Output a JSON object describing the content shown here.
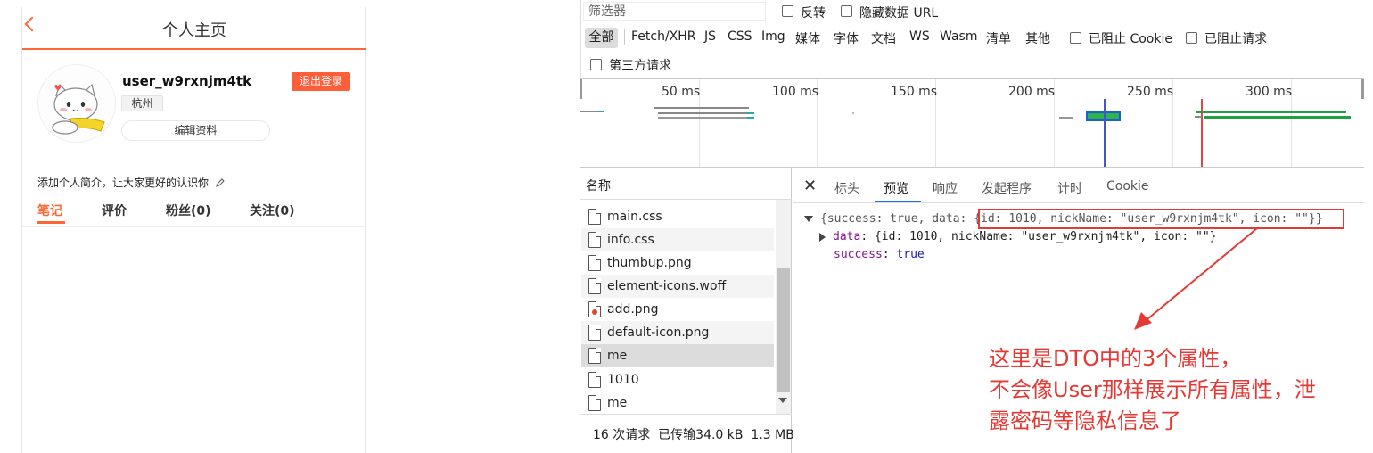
{
  "app": {
    "title": "个人主页",
    "username": "user_w9rxnjm4tk",
    "logout_label": "退出登录",
    "city": "杭州",
    "edit_profile_label": "编辑资料",
    "intro_placeholder": "添加个人简介，让大家更好的认识你",
    "tabs": [
      "笔记",
      "评价",
      "粉丝(0)",
      "关注(0)"
    ],
    "accent_color": "#ff6633"
  },
  "devtools": {
    "filter_placeholder": "筛选器",
    "invert_label": "反转",
    "hide_data_url_label": "隐藏数据 URL",
    "type_filters": [
      "全部",
      "Fetch/XHR",
      "JS",
      "CSS",
      "Img",
      "媒体",
      "字体",
      "文档",
      "WS",
      "Wasm",
      "清单",
      "其他"
    ],
    "blocked_cookies_label": "已阻止 Cookie",
    "blocked_requests_label": "已阻止请求",
    "third_party_label": "第三方请求",
    "timeline_ticks": [
      "50 ms",
      "100 ms",
      "150 ms",
      "200 ms",
      "250 ms",
      "300 ms"
    ],
    "column_name": "名称",
    "requests": [
      {
        "name": "main.css",
        "icon": "file-icon"
      },
      {
        "name": "info.css",
        "icon": "file-icon"
      },
      {
        "name": "thumbup.png",
        "icon": "image-file-icon"
      },
      {
        "name": "element-icons.woff",
        "icon": "file-icon"
      },
      {
        "name": "add.png",
        "icon": "image-file-icon"
      },
      {
        "name": "default-icon.png",
        "icon": "image-file-icon"
      },
      {
        "name": "me",
        "icon": "file-icon",
        "selected": true
      },
      {
        "name": "1010",
        "icon": "file-icon"
      },
      {
        "name": "me",
        "icon": "file-icon"
      }
    ],
    "summary": {
      "requests": "16 次请求",
      "transferred": "已传输34.0 kB",
      "resources": "1.3 MB"
    },
    "detail_tabs": [
      "标头",
      "预览",
      "响应",
      "发起程序",
      "计时",
      "Cookie"
    ],
    "active_detail_tab": "预览",
    "preview": {
      "line1_prefix": "{success: true, data: ",
      "line1_highlight": "{id: 1010, nickName: \"user_w9rxnjm4tk\", icon: \"\"}",
      "line1_suffix": "}",
      "data_key": "data",
      "data_value": "{id: 1010, nickName: \"user_w9rxnjm4tk\", icon: \"\"}",
      "success_key": "success",
      "success_value": "true"
    }
  },
  "annotation": {
    "line1": "这里是DTO中的3个属性，",
    "line2": "不会像User那样展示所有属性，泄",
    "line3": "露密码等隐私信息了",
    "color": "#e53935"
  }
}
